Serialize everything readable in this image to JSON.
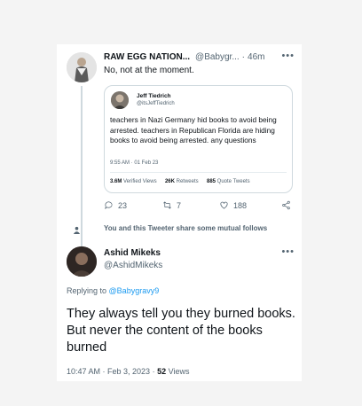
{
  "tweet1": {
    "name": "RAW EGG NATION...",
    "handle": "@Babygr...",
    "separator": "·",
    "time": "46m",
    "text": "No, not at the moment.",
    "more_icon": "more-horizontal-icon"
  },
  "quote": {
    "name": "Jeff Tiedrich",
    "handle": "@itsJeffTiedrich",
    "text": "teachers in Nazi Germany hid books to avoid being arrested. teachers in Republican Florida are hiding books to avoid being arrested. any questions",
    "time": "9:55 AM · 01 Feb 23",
    "views_count": "3.6M",
    "views_label": "Verified Views",
    "retweets_count": "26K",
    "retweets_label": "Retweets",
    "quotes_count": "885",
    "quotes_label": "Quote Tweets"
  },
  "actions": {
    "replies": "23",
    "retweets": "7",
    "likes": "188",
    "icons": [
      "reply-icon",
      "retweet-icon",
      "like-icon",
      "share-icon"
    ]
  },
  "mutual": {
    "text": "You and this Tweeter share some mutual follows",
    "icon": "person-icon"
  },
  "tweet2": {
    "name": "Ashid Mikeks",
    "handle": "@AshidMikeks",
    "replying_prefix": "Replying to",
    "replying_to": "@Babygravy9",
    "text": "They always tell you they burned books. But never the content of the books burned",
    "time": "10:47 AM · Feb 3, 2023",
    "separator": "·",
    "views_count": "52",
    "views_label": "Views"
  },
  "colors": {
    "link": "#1d9bf0",
    "secondary_text": "#536471",
    "primary_text": "#0f1419",
    "border": "#cfd9de"
  }
}
